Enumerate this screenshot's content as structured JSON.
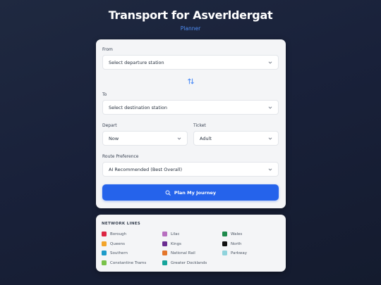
{
  "header": {
    "title": "Transport for Asverldergat",
    "subtitle": "Planner"
  },
  "planner": {
    "from": {
      "label": "From",
      "value": "Select departure station"
    },
    "to": {
      "label": "To",
      "value": "Select destination station"
    },
    "depart": {
      "label": "Depart",
      "value": "Now"
    },
    "ticket": {
      "label": "Ticket",
      "value": "Adult"
    },
    "route": {
      "label": "Route Preference",
      "value": "AI Recommended (Best Overall)"
    },
    "plan_button": "Plan My Journey",
    "swap_icon": "swap-arrows-icon",
    "accent_color": "#2563eb"
  },
  "network": {
    "title": "NETWORK LINES",
    "lines": [
      {
        "name": "Borough",
        "color": "#dc2643"
      },
      {
        "name": "Lilac",
        "color": "#b86fc0"
      },
      {
        "name": "Wales",
        "color": "#1e8a4c"
      },
      {
        "name": "Queens",
        "color": "#f2a42a"
      },
      {
        "name": "Kings",
        "color": "#6a2c91"
      },
      {
        "name": "North",
        "color": "#111111"
      },
      {
        "name": "Southern",
        "color": "#1d9bc9"
      },
      {
        "name": "National Rail",
        "color": "#e4762b"
      },
      {
        "name": "Parkway",
        "color": "#8fd3dc"
      },
      {
        "name": "Constantine Trams",
        "color": "#79c24a"
      },
      {
        "name": "Greater Docklands",
        "color": "#16a49b"
      }
    ]
  }
}
